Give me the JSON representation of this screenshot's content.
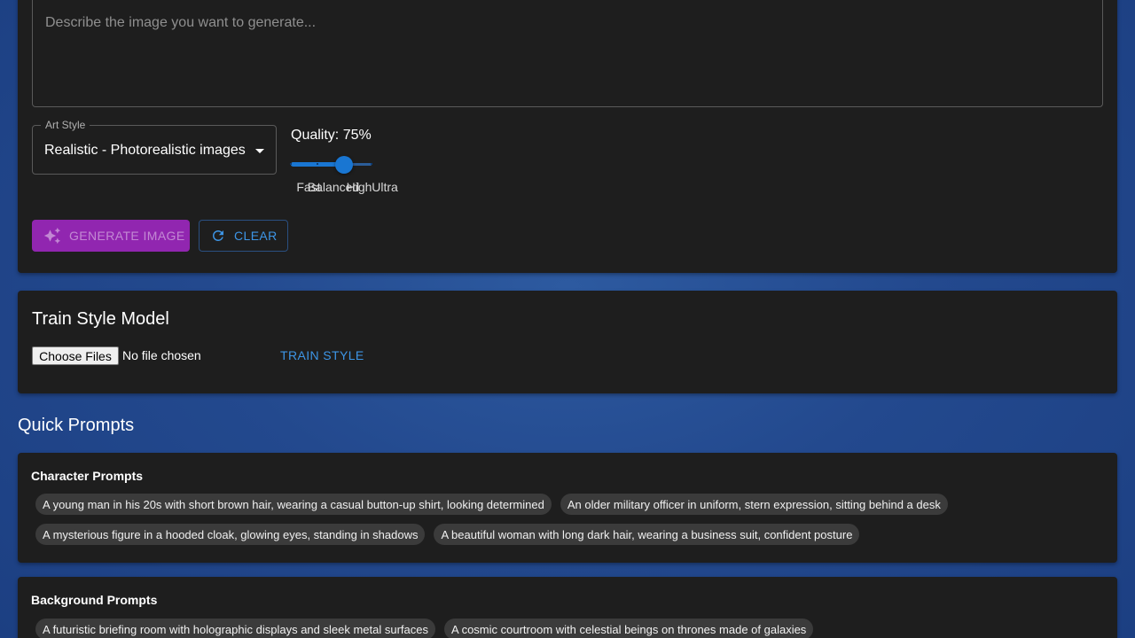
{
  "generator": {
    "prompt_placeholder": "Describe the image you want to generate...",
    "art_style_label": "Art Style",
    "art_style_value": "Realistic - Photorealistic images",
    "quality_label": "Quality: 75%",
    "quality_value": 75,
    "quality_marks": [
      "Fast",
      "Balanced",
      "High",
      "Ultra"
    ],
    "generate_label": "Generate Image",
    "clear_label": "Clear"
  },
  "train": {
    "title": "Train Style Model",
    "choose_files_label": "Choose Files",
    "no_file_text": "No file chosen",
    "train_label": "Train Style"
  },
  "quick_prompts": {
    "title": "Quick Prompts",
    "character": {
      "title": "Character Prompts",
      "row1": [
        "A young man in his 20s with short brown hair, wearing a casual button-up shirt, looking determined",
        "An older military officer in uniform, stern expression, sitting behind a desk"
      ],
      "row2": [
        "A mysterious figure in a hooded cloak, glowing eyes, standing in shadows",
        "A beautiful woman with long dark hair, wearing a business suit, confident posture"
      ]
    },
    "background": {
      "title": "Background Prompts",
      "row1": [
        "A futuristic briefing room with holographic displays and sleek metal surfaces",
        "A cosmic courtroom with celestial beings on thrones made of galaxies"
      ]
    }
  },
  "colors": {
    "accent": "#1976d2",
    "generate_button": "#9126b0",
    "card_bg": "#1e1e1e",
    "page_bg": "#23498e"
  }
}
